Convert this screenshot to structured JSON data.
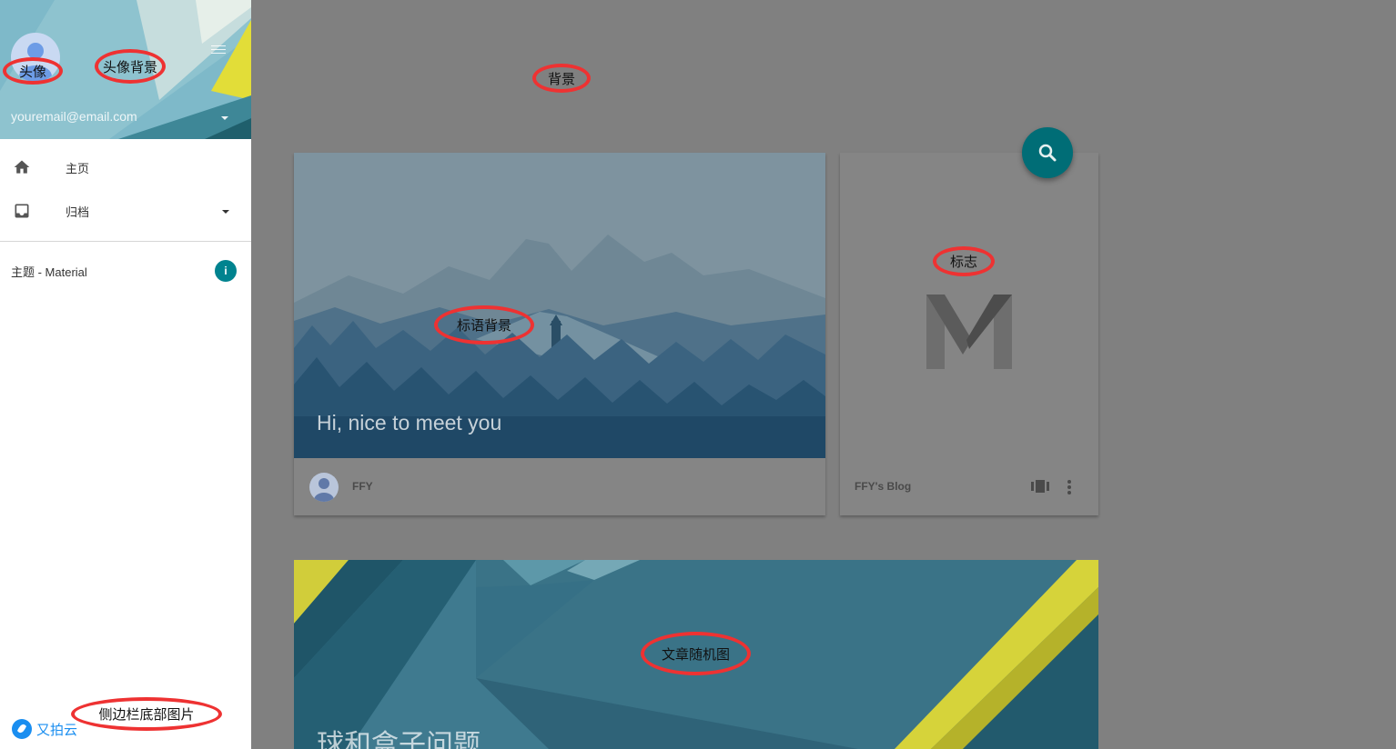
{
  "sidebar": {
    "email": "youremail@email.com",
    "nav": [
      {
        "label": "主页",
        "icon": "home-icon"
      },
      {
        "label": "归档",
        "icon": "inbox-icon"
      }
    ],
    "theme_label": "主题 - Material",
    "theme_badge": "i",
    "footer_logo_text": "又拍云"
  },
  "hero_card": {
    "slogan": "Hi, nice to meet you",
    "author": "FFY"
  },
  "blog_card": {
    "name": "FFY's Blog"
  },
  "post_card": {
    "title": "球和盒子问题"
  },
  "annotations": {
    "avatar": "头像",
    "avatar_bg": "头像背景",
    "background": "背景",
    "slogan_bg": "标语背景",
    "logo": "标志",
    "random_image": "文章随机图",
    "sidebar_bottom_image": "侧边栏底部图片"
  },
  "colors": {
    "page_bg": "#808080",
    "accent": "#00838f",
    "fab": "#006d76",
    "annotation": "#ee3232"
  }
}
